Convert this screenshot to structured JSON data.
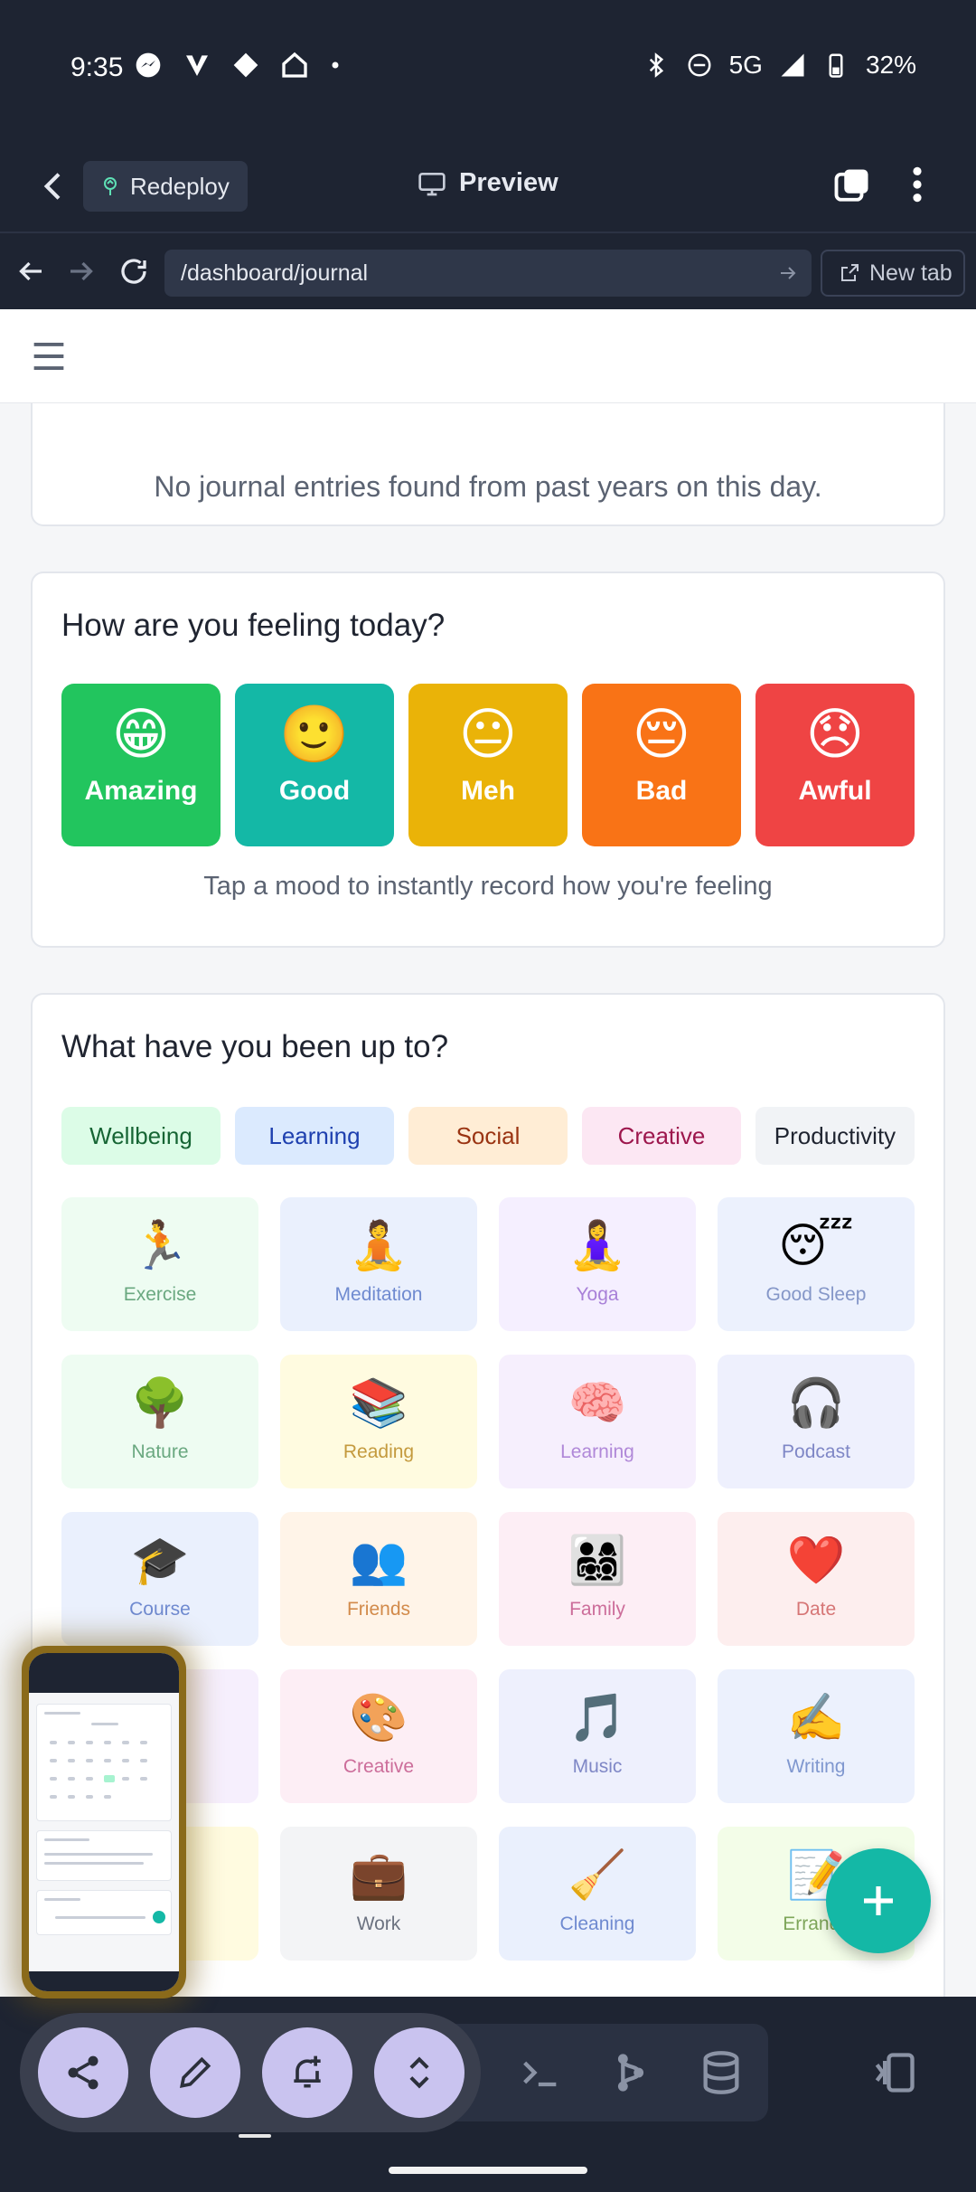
{
  "status_bar": {
    "time": "9:35",
    "network": "5G",
    "battery": "32%"
  },
  "header": {
    "redeploy_label": "Redeploy",
    "preview_label": "Preview"
  },
  "url_bar": {
    "url": "/dashboard/journal",
    "new_tab_label": "New tab"
  },
  "past_entries": {
    "message": "No journal entries found from past years on this day."
  },
  "mood_card": {
    "title": "How are you feeling today?",
    "moods": [
      {
        "emoji": "😁",
        "label": "Amazing",
        "color": "#22c55e"
      },
      {
        "emoji": "🙂",
        "label": "Good",
        "color": "#14b8a6"
      },
      {
        "emoji": "😐",
        "label": "Meh",
        "color": "#eab308"
      },
      {
        "emoji": "😔",
        "label": "Bad",
        "color": "#f97316"
      },
      {
        "emoji": "😞",
        "label": "Awful",
        "color": "#ef4444"
      }
    ],
    "hint": "Tap a mood to instantly record how you're feeling"
  },
  "activity_card": {
    "title": "What have you been up to?",
    "categories": [
      {
        "label": "Wellbeing",
        "bg": "#dcfce7",
        "fg": "#166534"
      },
      {
        "label": "Learning",
        "bg": "#dbeafe",
        "fg": "#1e40af"
      },
      {
        "label": "Social",
        "bg": "#ffedd5",
        "fg": "#9a3412"
      },
      {
        "label": "Creative",
        "bg": "#fce7f3",
        "fg": "#9d174d"
      },
      {
        "label": "Productivity",
        "bg": "#f1f3f6",
        "fg": "#1f2430"
      }
    ],
    "activities": [
      {
        "icon": "🏃",
        "label": "Exercise",
        "bg": "#eefcf2",
        "fg": "#6aa880"
      },
      {
        "icon": "🧘",
        "label": "Meditation",
        "bg": "#eaf0fd",
        "fg": "#6f8ad0"
      },
      {
        "icon": "🧘‍♀️",
        "label": "Yoga",
        "bg": "#f5efff",
        "fg": "#a880d8"
      },
      {
        "icon": "😴",
        "label": "Good Sleep",
        "bg": "#ecf1fd",
        "fg": "#8597c8"
      },
      {
        "icon": "🌳",
        "label": "Nature",
        "bg": "#eefcf2",
        "fg": "#6aa880"
      },
      {
        "icon": "📚",
        "label": "Reading",
        "bg": "#fffbe0",
        "fg": "#c49a3e"
      },
      {
        "icon": "🧠",
        "label": "Learning",
        "bg": "#f6effd",
        "fg": "#b088d8"
      },
      {
        "icon": "🎧",
        "label": "Podcast",
        "bg": "#eef0fd",
        "fg": "#7f87c6"
      },
      {
        "icon": "🎓",
        "label": "Course",
        "bg": "#eaf0fd",
        "fg": "#6f8ad0"
      },
      {
        "icon": "👥",
        "label": "Friends",
        "bg": "#fff4e8",
        "fg": "#d28a4a"
      },
      {
        "icon": "👨‍👩‍👧‍👦",
        "label": "Family",
        "bg": "#fdeef5",
        "fg": "#cc6d9a"
      },
      {
        "icon": "❤️",
        "label": "Date",
        "bg": "#fdeeee",
        "fg": "#d67676"
      },
      {
        "icon": "",
        "label": "",
        "bg": "#f6effd",
        "fg": "#b088d8"
      },
      {
        "icon": "🎨",
        "label": "Creative",
        "bg": "#fdeef5",
        "fg": "#cc6d9a"
      },
      {
        "icon": "🎵",
        "label": "Music",
        "bg": "#eef0fd",
        "fg": "#7f87c6"
      },
      {
        "icon": "✍️",
        "label": "Writing",
        "bg": "#ecf1fd",
        "fg": "#7f97cf"
      },
      {
        "icon": "",
        "label": "",
        "bg": "#fffbe0",
        "fg": "#c49a3e"
      },
      {
        "icon": "💼",
        "label": "Work",
        "bg": "#f3f4f6",
        "fg": "#6b7280"
      },
      {
        "icon": "🧹",
        "label": "Cleaning",
        "bg": "#eaf0fd",
        "fg": "#6f8ad0"
      },
      {
        "icon": "📝",
        "label": "Errands",
        "bg": "#f3fde8",
        "fg": "#7ea65a"
      }
    ]
  },
  "colors": {
    "accent": "#14b8a6",
    "dark_bg": "#1e2432",
    "bubble": "#c9c3ef"
  }
}
